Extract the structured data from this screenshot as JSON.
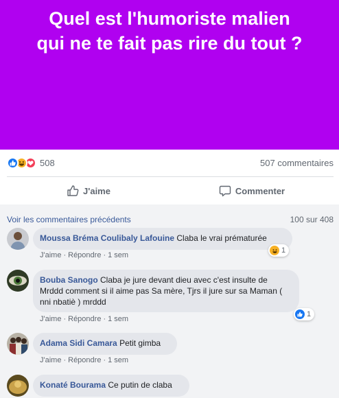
{
  "post": {
    "banner_line1": "Quel est l'humoriste malien",
    "banner_line2": "qui ne te fait pas rire du tout ?",
    "banner_color": "#b001f0",
    "reaction_count": "508",
    "reaction_types": [
      "like-icon",
      "haha-icon",
      "love-icon"
    ],
    "comments_count_label": "507 commentaires"
  },
  "actions": {
    "like_label": "J'aime",
    "comment_label": "Commenter"
  },
  "comments_section": {
    "previous_link": "Voir les commentaires précédents",
    "counter": "100 sur 408",
    "meta": {
      "like": "J'aime",
      "reply": "Répondre",
      "separator": "·"
    },
    "items": [
      {
        "author": "Moussa Bréma Coulibaly Lafouine",
        "text": "Claba le vrai prématurée",
        "time": "1 sem",
        "reaction": "haha-icon",
        "reaction_count": "1"
      },
      {
        "author": "Bouba Sanogo",
        "text_line1": "Claba je jure devant dieu avec c'est insulte de",
        "text_line2": "Mrddd comment si il aime pas Sa mère, Tjrs il jure sur sa Maman (",
        "text_line3": "nni nbatiè ) mrddd",
        "time": "1 sem",
        "reaction": "like-icon",
        "reaction_count": "1"
      },
      {
        "author": "Adama Sidi Camara",
        "text": "Petit gimba",
        "time": "1 sem"
      },
      {
        "author": "Konaté Bourama",
        "text": "Ce putin de claba"
      }
    ]
  }
}
